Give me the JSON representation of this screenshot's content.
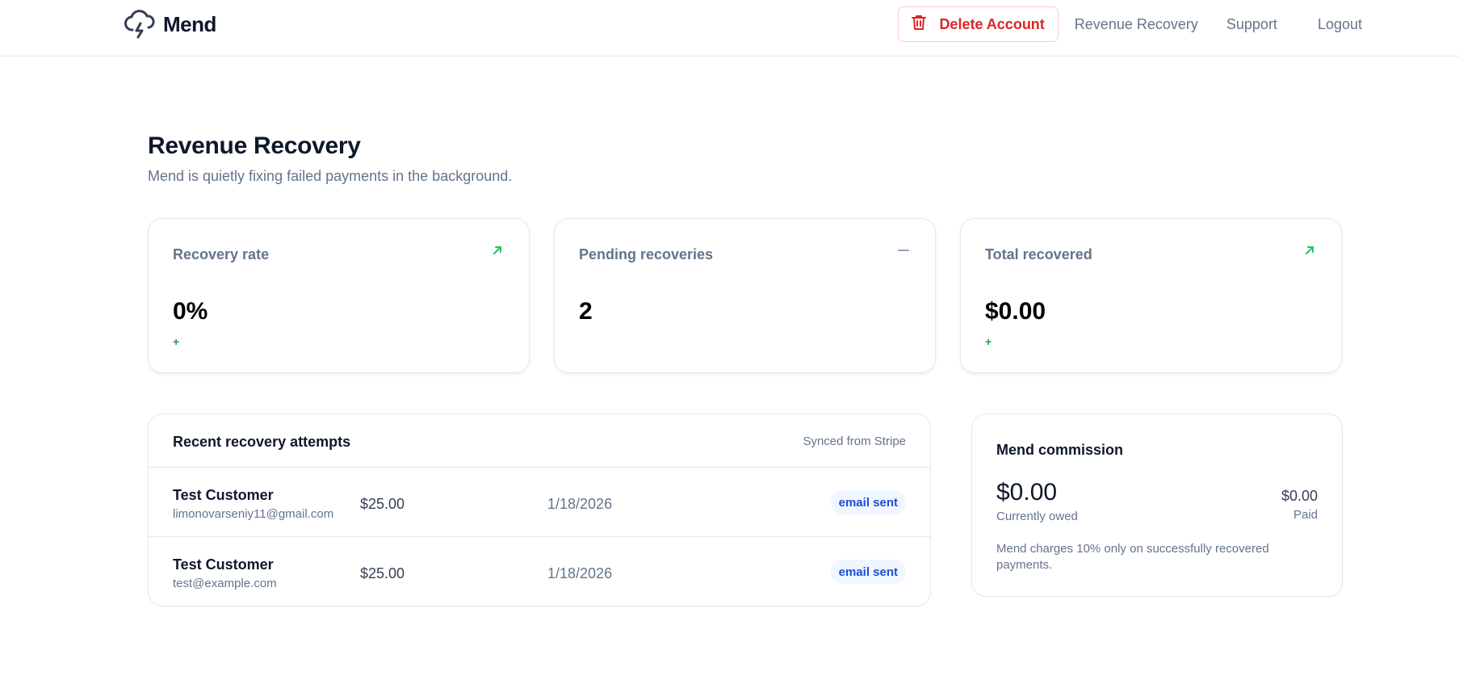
{
  "header": {
    "brand": "Mend",
    "delete_label": "Delete Account",
    "nav": {
      "revenue_recovery": "Revenue Recovery",
      "support": "Support",
      "logout": "Logout"
    }
  },
  "page": {
    "title": "Revenue Recovery",
    "subtitle": "Mend is quietly fixing failed payments in the background."
  },
  "stats": [
    {
      "label": "Recovery rate",
      "value": "0%",
      "delta": "+",
      "trend": "up"
    },
    {
      "label": "Pending recoveries",
      "value": "2",
      "delta": "",
      "trend": "flat"
    },
    {
      "label": "Total recovered",
      "value": "$0.00",
      "delta": "+",
      "trend": "up"
    }
  ],
  "attempts": {
    "title": "Recent recovery attempts",
    "sync_label": "Synced from Stripe",
    "rows": [
      {
        "name": "Test Customer",
        "email": "limonovarseniy11@gmail.com",
        "amount": "$25.00",
        "date": "1/18/2026",
        "status": "email sent"
      },
      {
        "name": "Test Customer",
        "email": "test@example.com",
        "amount": "$25.00",
        "date": "1/18/2026",
        "status": "email sent"
      }
    ]
  },
  "commission": {
    "title": "Mend commission",
    "owed_value": "$0.00",
    "owed_label": "Currently owed",
    "paid_value": "$0.00",
    "paid_label": "Paid",
    "note": "Mend charges 10% only on successfully recovered payments."
  },
  "colors": {
    "accent_danger": "#dc2626",
    "trend_up": "#22c55e",
    "badge_bg": "#eff6ff",
    "badge_text": "#1d4ed8"
  }
}
